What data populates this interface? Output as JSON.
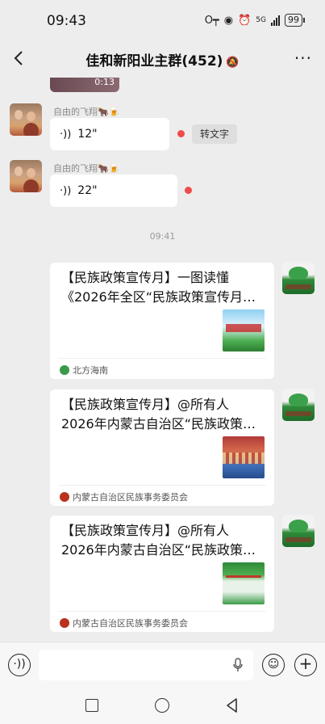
{
  "status_bar": {
    "time": "09:43",
    "network": "5G",
    "battery": "99"
  },
  "header": {
    "title": "佳和新阳业主群(452)",
    "back_icon": "chevron-left-icon",
    "mute_icon": "bell-off-icon",
    "more_label": "···"
  },
  "chat": {
    "video_duration": "0:13",
    "voice_messages": [
      {
        "sender": "自由的飞翔🐂🍺",
        "duration": "12\"",
        "to_text_label": "转文字",
        "unread": true
      },
      {
        "sender": "自由的飞翔🐂🍺",
        "duration": "22\"",
        "unread": true
      }
    ],
    "timestamp": "09:41",
    "cards": [
      {
        "title_line1": "【民族政策宣传月】一图读懂",
        "title_line2": "《2026年全区“民族政策宣传月…",
        "source": "北方海南",
        "source_color": "#3a9a4a"
      },
      {
        "title_line1": "【民族政策宣传月】@所有人",
        "title_line2": "2026年内蒙古自治区“民族政策…",
        "source": "内蒙古自治区民族事务委员会",
        "source_color": "#b8321e"
      },
      {
        "title_line1": "【民族政策宣传月】@所有人",
        "title_line2": "2026年内蒙古自治区“民族政策…",
        "source": "内蒙古自治区民族事务委员会",
        "source_color": "#b8321e"
      }
    ]
  },
  "input_bar": {
    "voice_icon": "voice-icon",
    "mic_icon": "mic-icon",
    "emoji_icon": "emoji-icon",
    "add_icon": "plus-icon"
  },
  "nav": {
    "recent_icon": "square-icon",
    "home_icon": "circle-icon",
    "back_icon": "triangle-back-icon"
  }
}
